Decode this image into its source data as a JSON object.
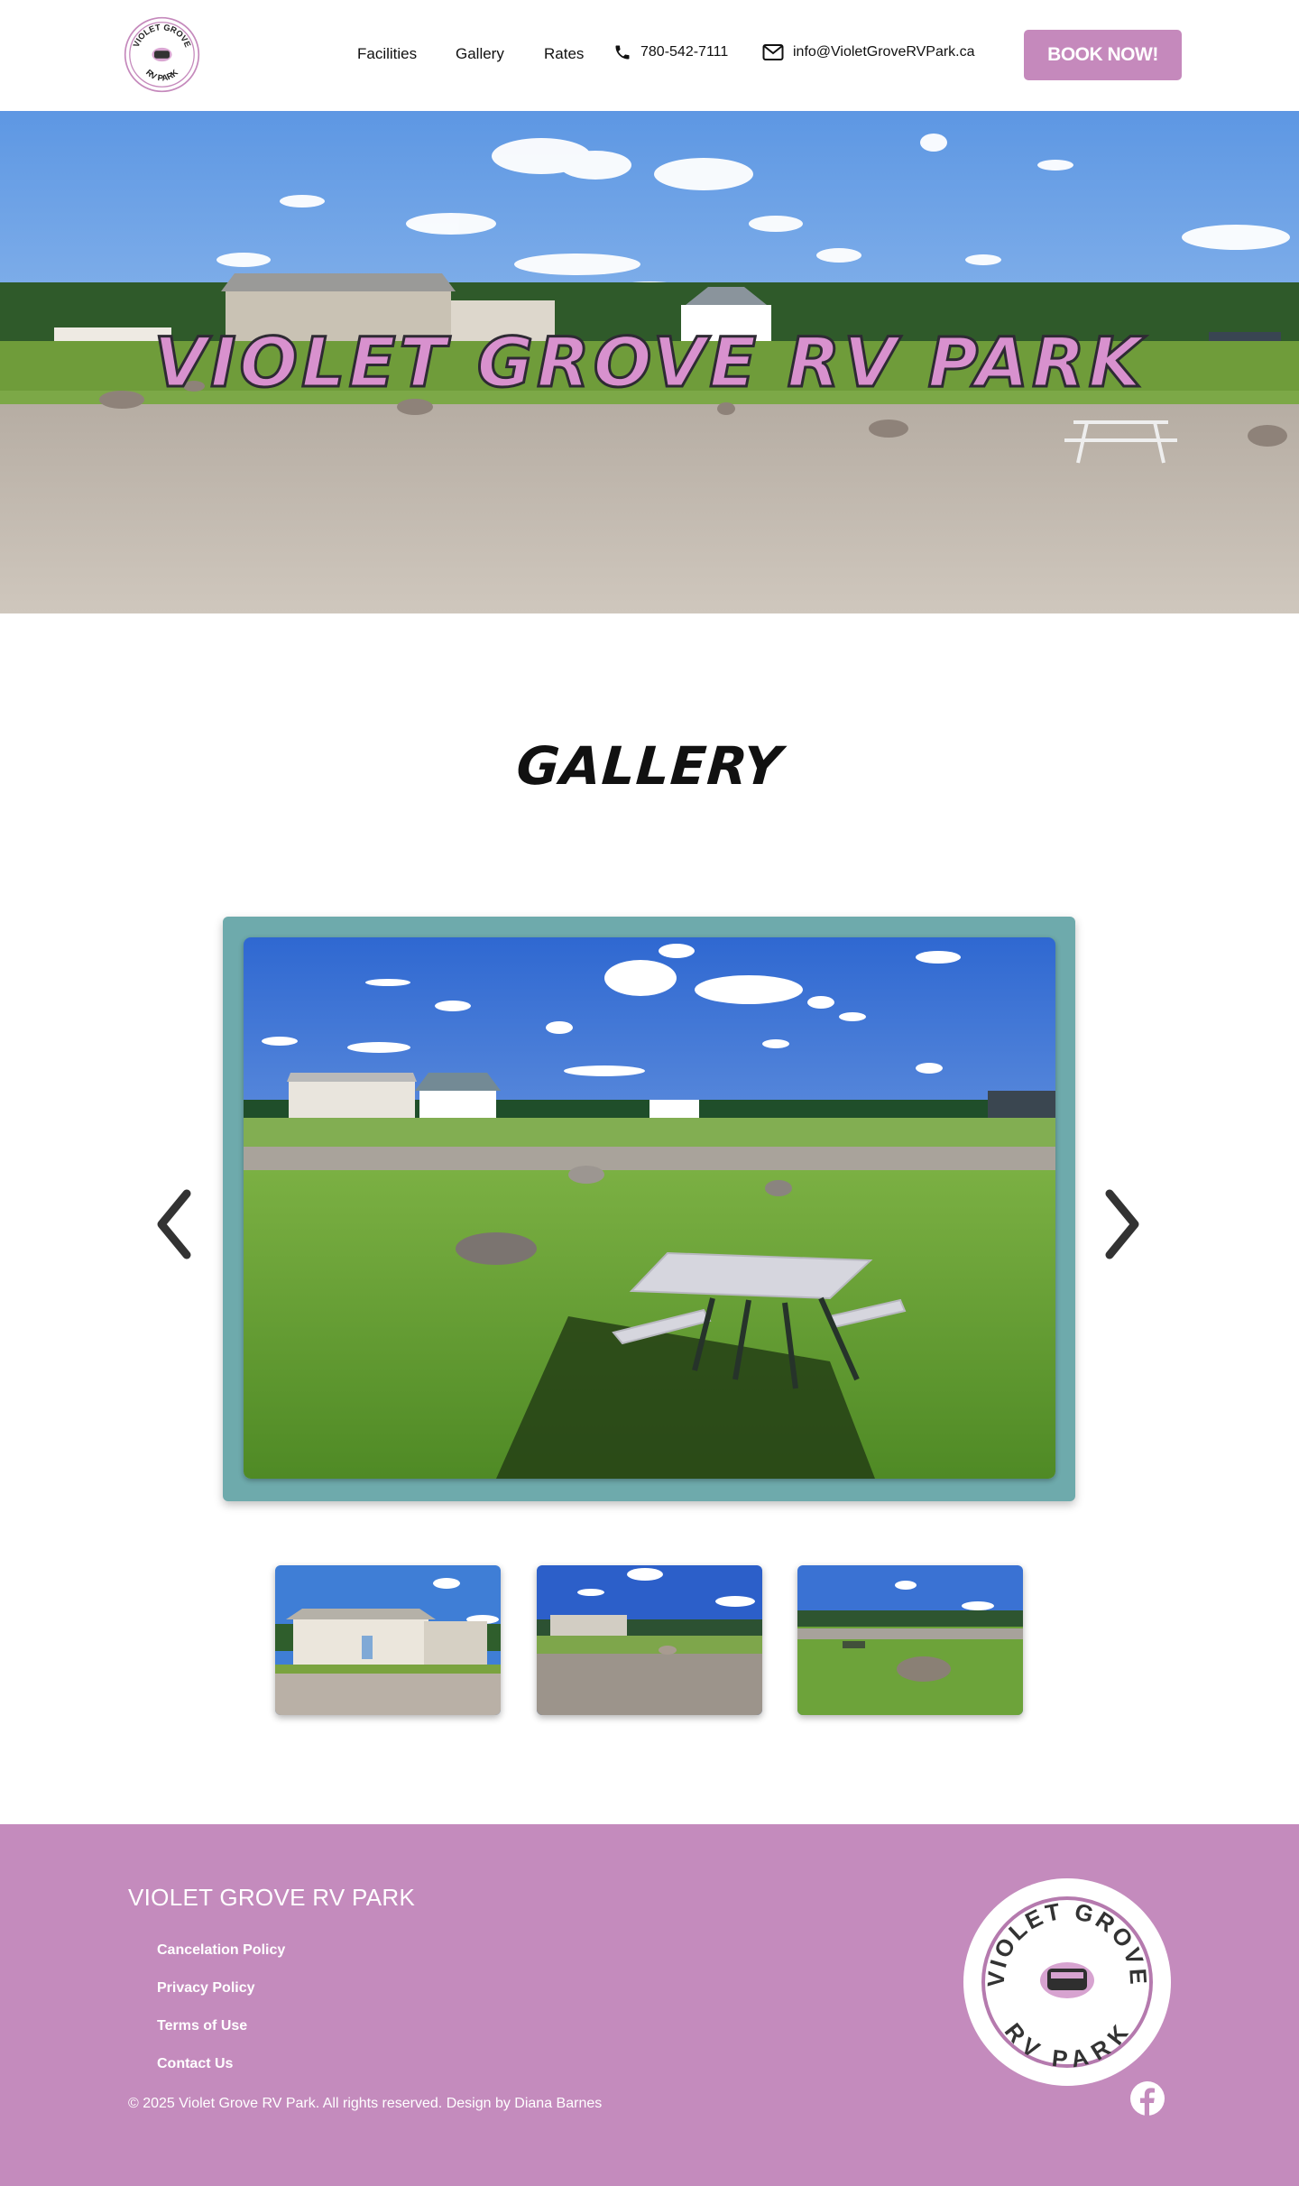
{
  "header": {
    "logo_top_text": "VIOLET GROVE",
    "logo_bottom_text": "RV PARK",
    "nav": [
      {
        "label": "Facilities"
      },
      {
        "label": "Gallery"
      },
      {
        "label": "Rates"
      }
    ],
    "phone": {
      "icon": "phone-icon",
      "label": "780-542-7111"
    },
    "email": {
      "icon": "mail-icon",
      "label": "info@VioletGroveRVPark.ca"
    },
    "book_button": "BOOK NOW!"
  },
  "hero": {
    "title": "VIOLET GROVE RV PARK"
  },
  "gallery": {
    "heading": "GALLERY",
    "prev_icon": "chevron-left-icon",
    "next_icon": "chevron-right-icon",
    "thumbnail_count": 3
  },
  "footer": {
    "title": "VIOLET GROVE RV PARK",
    "links": [
      {
        "label": "Cancelation Policy"
      },
      {
        "label": "Privacy Policy"
      },
      {
        "label": "Terms of Use"
      },
      {
        "label": "Contact Us"
      }
    ],
    "copyright": "© 2025 Violet Grove RV Park. All rights reserved. Design by Diana Barnes",
    "logo_top_text": "VIOLET GROVE",
    "logo_bottom_text": "RV PARK",
    "social_icon": "facebook-icon"
  },
  "colors": {
    "accent": "#c589bc",
    "frame": "#6eaaac",
    "footer_bg": "#c48bbd"
  }
}
